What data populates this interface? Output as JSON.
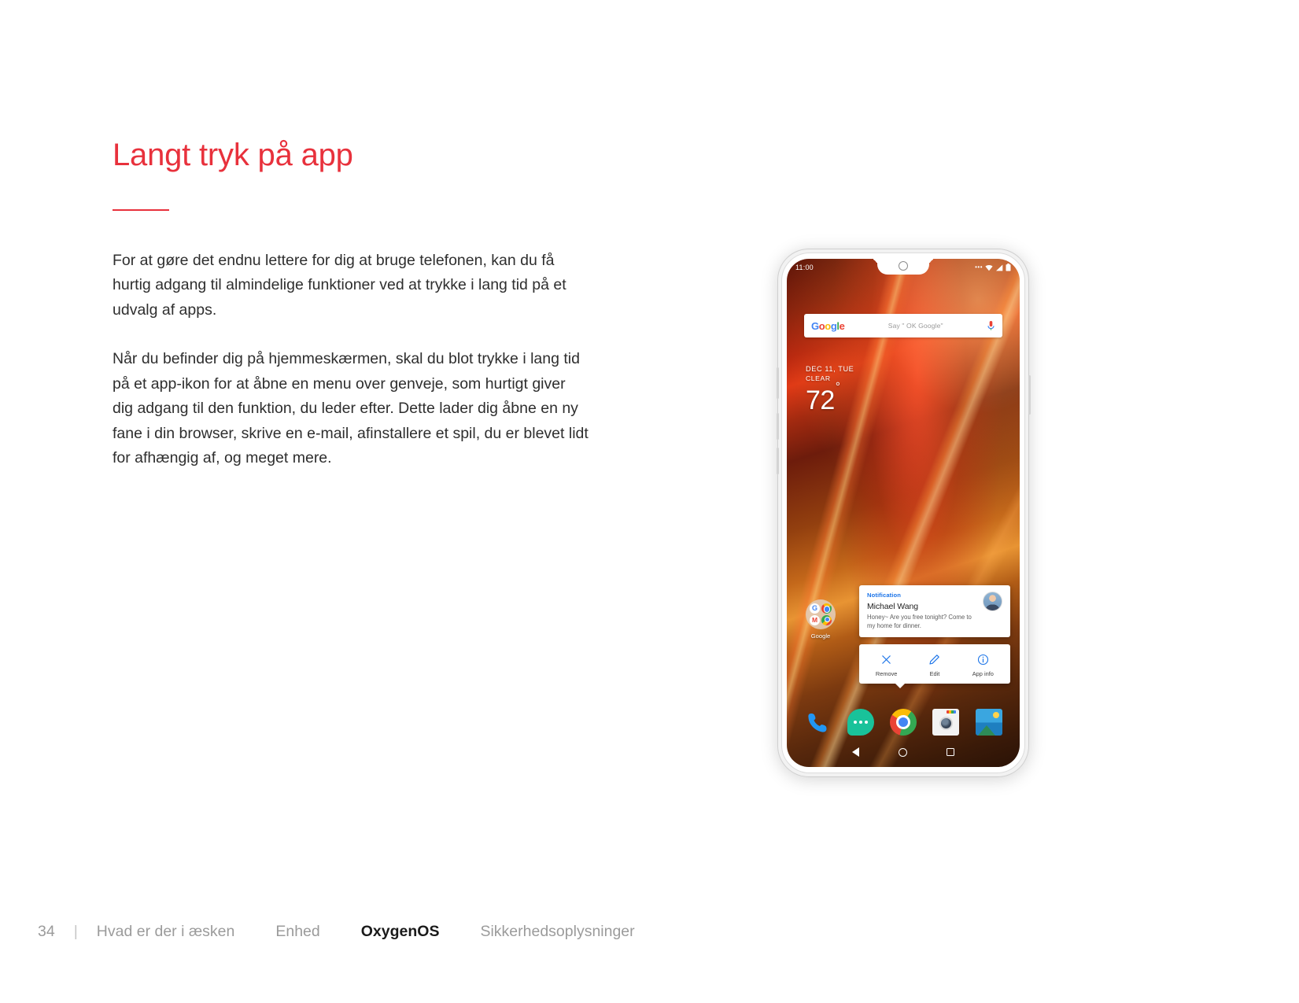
{
  "page": {
    "title": "Langt tryk på app",
    "paragraphs": [
      "For at gøre det endnu lettere for dig at bruge telefonen, kan du få hurtig adgang til almindelige funktioner ved at trykke i lang tid på et udvalg af apps.",
      "Når du befinder dig på hjemmeskærmen, skal du blot trykke i lang tid på et app-ikon for at åbne en menu over genveje, som hurtigt giver dig adgang til den funktion, du leder efter. Dette lader dig åbne en ny fane i din browser, skrive en e-mail, afinstallere et spil, du er blevet lidt for afhængig af, og meget mere."
    ],
    "accent_color": "#e8313c"
  },
  "footer": {
    "page_number": "34",
    "separator": "|",
    "items": [
      {
        "label": "Hvad er der i æsken",
        "active": false
      },
      {
        "label": "Enhed",
        "active": false
      },
      {
        "label": "OxygenOS",
        "active": true
      },
      {
        "label": "Sikkerhedsoplysninger",
        "active": false
      }
    ]
  },
  "phone": {
    "status_bar": {
      "time": "11:00",
      "overflow_dots": "•••",
      "icons": [
        "wifi-icon",
        "signal-icon",
        "battery-icon"
      ]
    },
    "search_widget": {
      "logo_letters": [
        "G",
        "o",
        "o",
        "g",
        "l",
        "e"
      ],
      "hint": "Say \" OK Google\"",
      "mic_icon": "microphone-icon"
    },
    "weather": {
      "date": "DEC 11, TUE",
      "condition": "CLEAR",
      "temperature": "72",
      "degree": "°"
    },
    "folder": {
      "label": "Google",
      "apps": [
        "google-search-icon",
        "chrome-icon",
        "gmail-icon",
        "maps-icon"
      ]
    },
    "notification": {
      "kind": "Notification",
      "sender": "Michael Wang",
      "message": "Honey~ Are you free tonight? Come to my home for dinner.",
      "avatar": "contact-avatar"
    },
    "shortcut_actions": [
      {
        "label": "Remove",
        "icon": "close-icon"
      },
      {
        "label": "Edit",
        "icon": "pencil-icon"
      },
      {
        "label": "App info",
        "icon": "info-icon"
      }
    ],
    "dock": [
      {
        "name": "phone-icon"
      },
      {
        "name": "messages-icon"
      },
      {
        "name": "chrome-icon"
      },
      {
        "name": "camera-icon"
      },
      {
        "name": "photos-icon"
      }
    ],
    "nav_bar": [
      {
        "name": "back-button"
      },
      {
        "name": "home-button"
      },
      {
        "name": "recents-button"
      }
    ]
  }
}
